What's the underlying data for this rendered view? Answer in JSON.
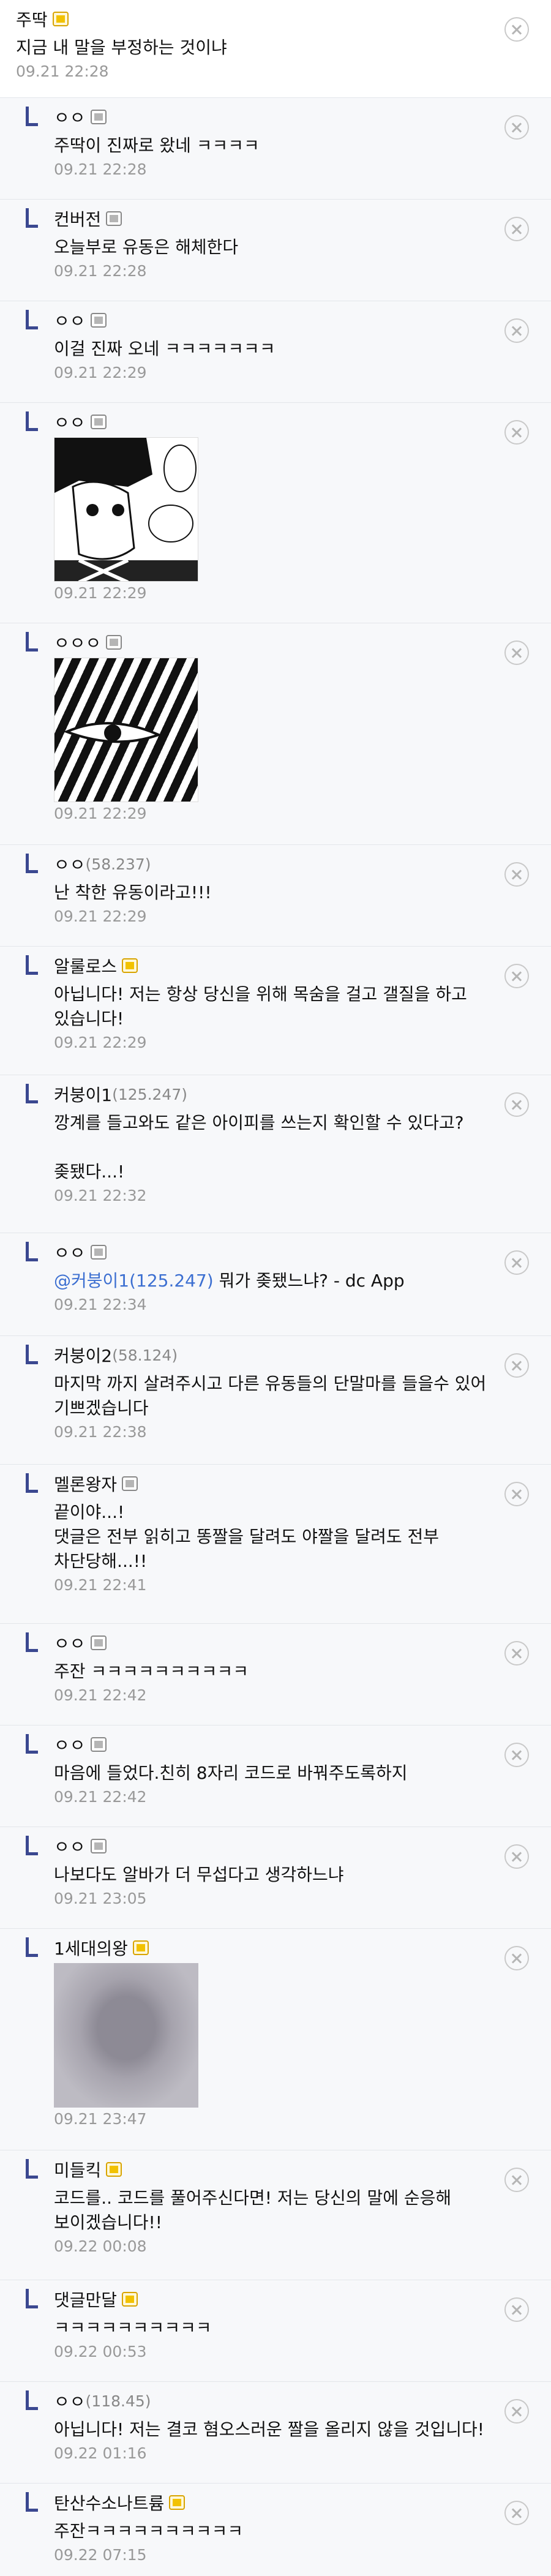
{
  "comments": [
    {
      "nick": "주딱",
      "ip": "",
      "badge": "y",
      "text": "지금 내 말을 부정하는 것이냐",
      "date": "09.21 22:28"
    },
    {
      "nick": "ㅇㅇ",
      "ip": "",
      "badge": "g",
      "text": "주딱이 진짜로 왔네 ㅋㅋㅋㅋ",
      "date": "09.21 22:28"
    },
    {
      "nick": "컨버전",
      "ip": "",
      "badge": "g",
      "text": "오늘부로 유동은 해체한다",
      "date": "09.21 22:28"
    },
    {
      "nick": "ㅇㅇ",
      "ip": "",
      "badge": "g",
      "text": "이걸 진짜 오네 ㅋㅋㅋㅋㅋㅋㅋ",
      "date": "09.21 22:29"
    },
    {
      "nick": "ㅇㅇ",
      "ip": "",
      "badge": "g",
      "text": "",
      "date": "09.21 22:29",
      "image": "manga-face-image"
    },
    {
      "nick": "ㅇㅇㅇ",
      "ip": "",
      "badge": "g",
      "text": "",
      "date": "09.21 22:29",
      "image": "manga-stripes-image"
    },
    {
      "nick": "ㅇㅇ",
      "ip": "(58.237)",
      "badge": "",
      "text": "난 착한 유동이라고!!!",
      "date": "09.21 22:29"
    },
    {
      "nick": "알룰로스",
      "ip": "",
      "badge": "y",
      "text": "아닙니다! 저는 항상 당신을 위해 목숨을 걸고 갤질을 하고 있습니다!",
      "date": "09.21 22:29"
    },
    {
      "nick": "커붕이1",
      "ip": "(125.247)",
      "badge": "",
      "text": "깡계를 들고와도 같은 아이피를 쓰는지 확인할 수 있다고?\n\n좆됐다...!",
      "date": "09.21 22:32"
    },
    {
      "nick": "ㅇㅇ",
      "ip": "",
      "badge": "g",
      "mention": "@커붕이1(125.247)",
      "text": " 뭐가 좆됐느냐? - dc App",
      "date": "09.21 22:34"
    },
    {
      "nick": "커붕이2",
      "ip": "(58.124)",
      "badge": "",
      "text": "마지막 까지 살려주시고 다른 유동들의 단말마를 들을수 있어 기쁘겠습니다",
      "date": "09.21 22:38"
    },
    {
      "nick": "멜론왕자",
      "ip": "",
      "badge": "g",
      "text": "끝이야...!\n댓글은 전부 읽히고 똥짤을 달려도 야짤을 달려도 전부 차단당해...!!",
      "date": "09.21 22:41"
    },
    {
      "nick": "ㅇㅇ",
      "ip": "",
      "badge": "g",
      "text": "주잔 ㅋㅋㅋㅋㅋㅋㅋㅋㅋㅋ",
      "date": "09.21 22:42"
    },
    {
      "nick": "ㅇㅇ",
      "ip": "",
      "badge": "g",
      "text": "마음에 들었다.친히 8자리 코드로 바꿔주도록하지",
      "date": "09.21 22:42"
    },
    {
      "nick": "ㅇㅇ",
      "ip": "",
      "badge": "g",
      "text": "나보다도 알바가 더 무섭다고 생각하느냐",
      "date": "09.21 23:05"
    },
    {
      "nick": "1세대의왕",
      "ip": "",
      "badge": "y",
      "text": "",
      "date": "09.21 23:47",
      "image": "blurry-face-image"
    },
    {
      "nick": "미들킥",
      "ip": "",
      "badge": "y",
      "text": "코드를.. 코드를 풀어주신다면! 저는 당신의 말에 순응해 보이겠습니다!!",
      "date": "09.22 00:08"
    },
    {
      "nick": "댓글만달",
      "ip": "",
      "badge": "y",
      "text": "ㅋㅋㅋㅋㅋㅋㅋㅋㅋㅋ",
      "date": "09.22 00:53"
    },
    {
      "nick": "ㅇㅇ",
      "ip": "(118.45)",
      "badge": "",
      "text": "아닙니다! 저는 결코 혐오스러운 짤을 올리지 않을 것입니다!",
      "date": "09.22 01:16"
    },
    {
      "nick": "탄산수소나트륨",
      "ip": "",
      "badge": "y",
      "text": "주잔ㅋㅋㅋㅋㅋㅋㅋㅋㅋㅋ",
      "date": "09.22 07:15"
    }
  ]
}
